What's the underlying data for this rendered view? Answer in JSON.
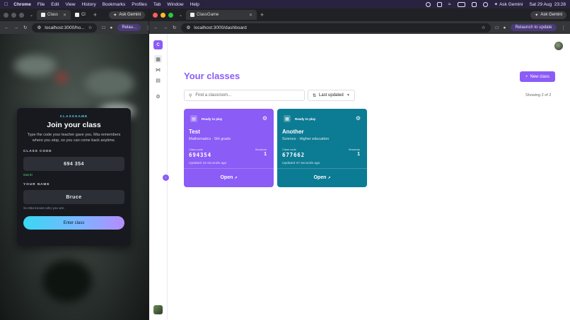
{
  "menubar": {
    "app": "Chrome",
    "items": [
      "File",
      "Edit",
      "View",
      "History",
      "Bookmarks",
      "Profiles",
      "Tab",
      "Window",
      "Help"
    ],
    "datetime": "Sat 29 Aug  23:28",
    "ask_gemini": "Ask Gemini"
  },
  "left_window": {
    "tabs": [
      {
        "label": "Class"
      },
      {
        "label": "Cl"
      }
    ],
    "ask_gemini": "Ask Gemini",
    "url": "localhost:3000/ho...",
    "relaunch": "Relau..."
  },
  "join": {
    "brand": "CLASSGAME",
    "title": "Join your class",
    "description": "Type the code your teacher gave you. Mia remembers where you stop, so you can come back anytime.",
    "code_label": "CLASS CODE",
    "code_value": "694 354",
    "code_hint": "Got it!",
    "name_label": "YOUR NAME",
    "name_value": "Bruce",
    "name_hint": "So Mia knows who you are.",
    "enter_label": "Enter class"
  },
  "right_window": {
    "tab_label": "ClassGame",
    "ask_gemini": "Ask Gemini",
    "url": "localhost:3000/dashboard",
    "relaunch": "Relaunch to update"
  },
  "dashboard": {
    "logo_letter": "C",
    "title": "Your classes",
    "new_class": "New class",
    "search_placeholder": "Find a classroom...",
    "sort_label": "Last updated",
    "showing": "Showing 2 of 2",
    "classes": [
      {
        "status": "Ready to play",
        "name": "Test",
        "subtitle": "Mathematics · 5th grade",
        "code_label": "Class code",
        "code": "694354",
        "sessions_label": "Sessions",
        "sessions": "1",
        "updated": "Updated 18 seconds ago",
        "open_label": "Open",
        "color": "#8b5cf6"
      },
      {
        "status": "Ready to play",
        "name": "Another",
        "subtitle": "Science · Higher education",
        "code_label": "Class code",
        "code": "677662",
        "sessions_label": "Sessions",
        "sessions": "1",
        "updated": "Updated 47 seconds ago",
        "open_label": "Open",
        "color": "#0c7b94"
      }
    ]
  }
}
